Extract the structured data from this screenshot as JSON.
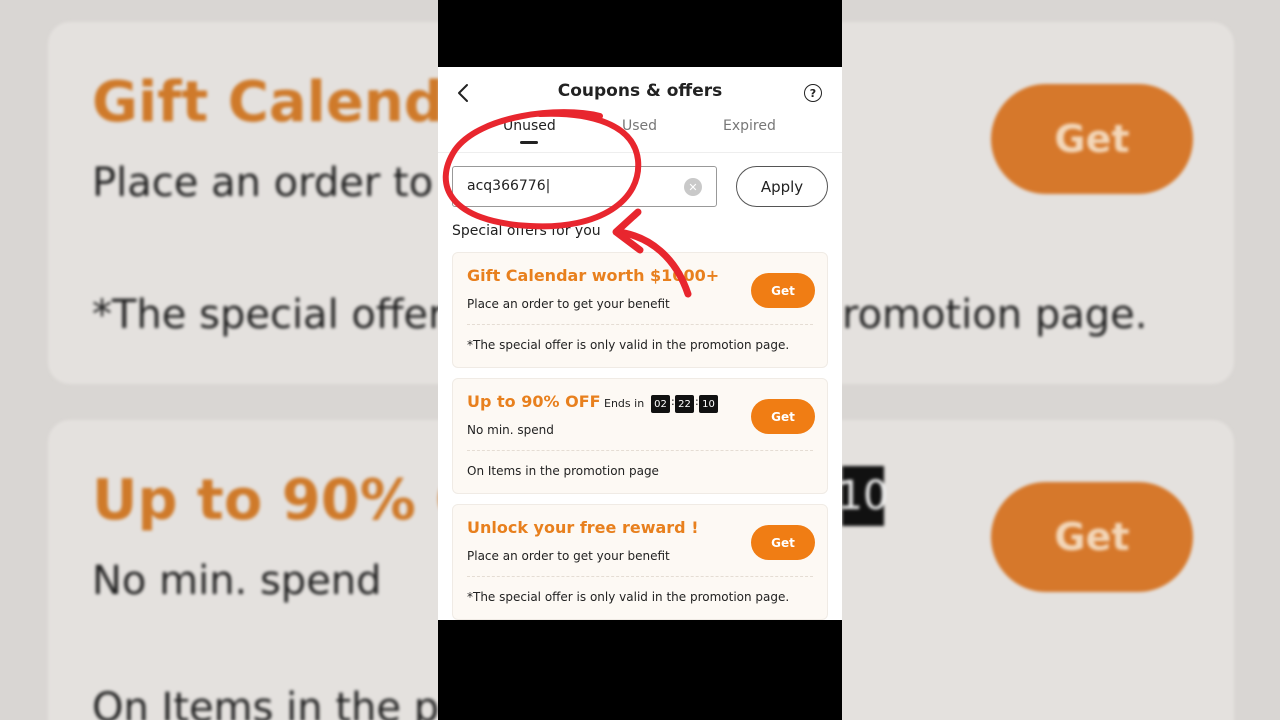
{
  "background": {
    "cards": [
      {
        "title": "Gift Calenda",
        "subtitle": "Place an order to",
        "note": "*The special offer",
        "note_right": "romotion page.",
        "get_label": "Get"
      },
      {
        "title": "Up to 90% O",
        "subtitle": "No min. spend",
        "note": "On Items in the pr",
        "timer_fragment": "10",
        "get_label": "Get"
      }
    ]
  },
  "header": {
    "title": "Coupons & offers",
    "back_icon": "chevron-left-icon",
    "help_icon": "question-circle-icon",
    "help_glyph": "?"
  },
  "tabs": [
    {
      "label": "Unused",
      "active": true
    },
    {
      "label": "Used",
      "active": false
    },
    {
      "label": "Expired",
      "active": false
    }
  ],
  "coupon_input": {
    "value": "acq366776|",
    "clear_glyph": "✕"
  },
  "apply_button": {
    "label": "Apply"
  },
  "section_title": "Special offers for you",
  "offers": [
    {
      "title": "Gift Calendar worth $1000+",
      "subtitle": "Place an order to get your benefit",
      "note": "*The special offer is only valid in the promotion page.",
      "get_label": "Get"
    },
    {
      "title": "Up to 90% OFF",
      "ends_label": "Ends in",
      "timer": [
        "02",
        "22",
        "10"
      ],
      "timer_sep": ":",
      "subtitle": "No min. spend",
      "note": "On Items in the promotion page",
      "get_label": "Get"
    },
    {
      "title": "Unlock your free reward !",
      "subtitle": "Place an order to get your benefit",
      "note": "*The special offer is only valid in the promotion page.",
      "get_label": "Get"
    }
  ],
  "colors": {
    "accent": "#f07d14",
    "annotation": "#e8262e"
  }
}
